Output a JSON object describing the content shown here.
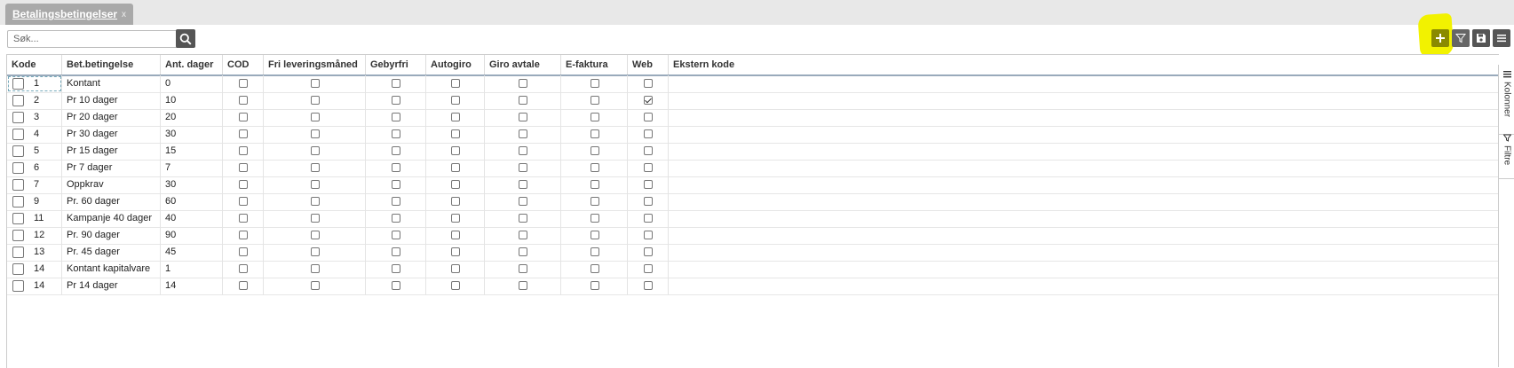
{
  "tab": {
    "label": "Betalingsbetingelser",
    "close": "x"
  },
  "search": {
    "placeholder": "Søk...",
    "value": ""
  },
  "toolbar_icons": [
    "add-icon",
    "filter-icon",
    "save-icon",
    "menu-icon"
  ],
  "colors": {
    "highlight": "#f2f200",
    "add_button": "#8a8a00",
    "toolbar_button": "#555555"
  },
  "columns": [
    "Kode",
    "Bet.betingelse",
    "Ant. dager",
    "COD",
    "Fri leveringsmåned",
    "Gebyrfri",
    "Autogiro",
    "Giro avtale",
    "E-faktura",
    "Web",
    "Ekstern kode"
  ],
  "rows": [
    {
      "kode": "1",
      "bet": "Kontant",
      "dager": "0",
      "cod": false,
      "fri": false,
      "gebyrfri": false,
      "autogiro": false,
      "giro": false,
      "efaktura": false,
      "web": false
    },
    {
      "kode": "2",
      "bet": "Pr 10 dager",
      "dager": "10",
      "cod": false,
      "fri": false,
      "gebyrfri": false,
      "autogiro": false,
      "giro": false,
      "efaktura": false,
      "web": true
    },
    {
      "kode": "3",
      "bet": "Pr 20 dager",
      "dager": "20",
      "cod": false,
      "fri": false,
      "gebyrfri": false,
      "autogiro": false,
      "giro": false,
      "efaktura": false,
      "web": false
    },
    {
      "kode": "4",
      "bet": "Pr 30 dager",
      "dager": "30",
      "cod": false,
      "fri": false,
      "gebyrfri": false,
      "autogiro": false,
      "giro": false,
      "efaktura": false,
      "web": false
    },
    {
      "kode": "5",
      "bet": "Pr 15 dager",
      "dager": "15",
      "cod": false,
      "fri": false,
      "gebyrfri": false,
      "autogiro": false,
      "giro": false,
      "efaktura": false,
      "web": false
    },
    {
      "kode": "6",
      "bet": "Pr 7 dager",
      "dager": "7",
      "cod": false,
      "fri": false,
      "gebyrfri": false,
      "autogiro": false,
      "giro": false,
      "efaktura": false,
      "web": false
    },
    {
      "kode": "7",
      "bet": "Oppkrav",
      "dager": "30",
      "cod": false,
      "fri": false,
      "gebyrfri": false,
      "autogiro": false,
      "giro": false,
      "efaktura": false,
      "web": false
    },
    {
      "kode": "9",
      "bet": "Pr. 60 dager",
      "dager": "60",
      "cod": false,
      "fri": false,
      "gebyrfri": false,
      "autogiro": false,
      "giro": false,
      "efaktura": false,
      "web": false
    },
    {
      "kode": "11",
      "bet": "Kampanje 40 dager",
      "dager": "40",
      "cod": false,
      "fri": false,
      "gebyrfri": false,
      "autogiro": false,
      "giro": false,
      "efaktura": false,
      "web": false
    },
    {
      "kode": "12",
      "bet": "Pr. 90 dager",
      "dager": "90",
      "cod": false,
      "fri": false,
      "gebyrfri": false,
      "autogiro": false,
      "giro": false,
      "efaktura": false,
      "web": false
    },
    {
      "kode": "13",
      "bet": "Pr. 45 dager",
      "dager": "45",
      "cod": false,
      "fri": false,
      "gebyrfri": false,
      "autogiro": false,
      "giro": false,
      "efaktura": false,
      "web": false
    },
    {
      "kode": "14",
      "bet": "Kontant kapitalvare",
      "dager": "1",
      "cod": false,
      "fri": false,
      "gebyrfri": false,
      "autogiro": false,
      "giro": false,
      "efaktura": false,
      "web": false
    },
    {
      "kode": "14",
      "bet": "Pr 14 dager",
      "dager": "14",
      "cod": false,
      "fri": false,
      "gebyrfri": false,
      "autogiro": false,
      "giro": false,
      "efaktura": false,
      "web": false
    }
  ],
  "side_panel": {
    "columns_label": "Kolonner",
    "filter_label": "Filtre"
  }
}
